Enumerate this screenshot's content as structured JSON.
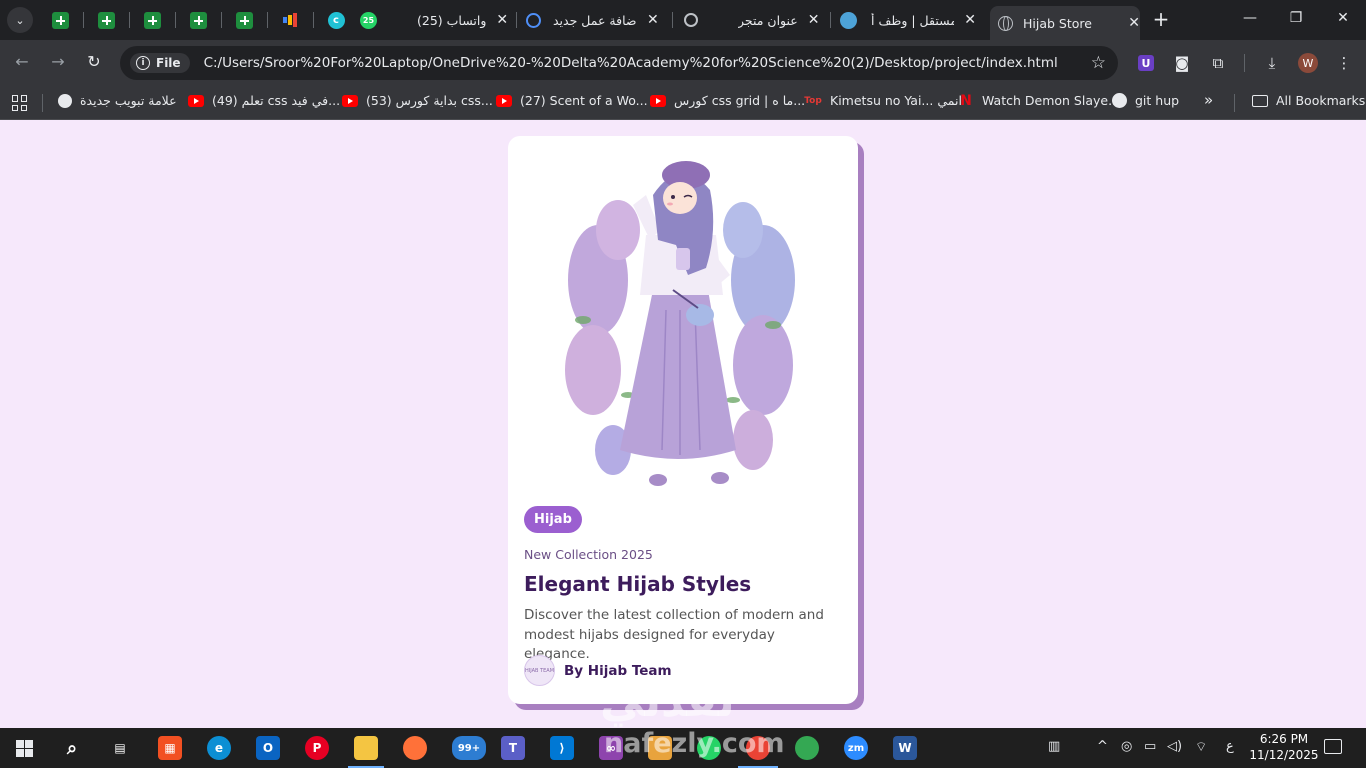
{
  "browser": {
    "tabs": [
      {
        "title": "",
        "icon": "sheets-icon"
      },
      {
        "title": "",
        "icon": "sheets-icon"
      },
      {
        "title": "",
        "icon": "sheets-icon"
      },
      {
        "title": "",
        "icon": "sheets-icon"
      },
      {
        "title": "",
        "icon": "sheets-icon"
      },
      {
        "title": "",
        "icon": "analytics-icon"
      },
      {
        "title": "",
        "icon": "canva-icon"
      },
      {
        "title": "(25) واتساب",
        "icon": "whatsapp-icon",
        "badge": "25"
      },
      {
        "title": "إضافة عمل جديد",
        "icon": "loading-icon"
      },
      {
        "title": "عنوان متجر",
        "icon": "openai-icon"
      },
      {
        "title": "مستقل | وظف أ",
        "icon": "mostaql-icon"
      },
      {
        "title": "Hijab Store",
        "icon": "globe-icon",
        "active": true
      }
    ],
    "site_label": "File",
    "url": "C:/Users/Sroor%20For%20Laptop/OneDrive%20-%20Delta%20Academy%20for%20Science%20(2)/Desktop/project/index.html",
    "profile_initial": "W",
    "extension_label": "U",
    "bookmarks": [
      {
        "label": "علامة تبويب جديدة",
        "icon": "globe-icon"
      },
      {
        "label": "(49) تعلم css في فيد...",
        "icon": "youtube-icon"
      },
      {
        "label": "(53) بداية كورس css...",
        "icon": "youtube-icon"
      },
      {
        "label": "(27) Scent of a Wo...",
        "icon": "youtube-icon"
      },
      {
        "label": "كورس css grid | ما ه...",
        "icon": "youtube-icon"
      },
      {
        "label": "Kimetsu no Yai... انمي",
        "icon": "top-icon"
      },
      {
        "label": "Watch Demon Slaye...",
        "icon": "netflix-icon"
      },
      {
        "label": "git hup",
        "icon": "github-icon"
      }
    ],
    "top_site_label": "Top",
    "netflix_label": "N",
    "more_bookmarks": "»",
    "all_bookmarks": "All Bookmarks"
  },
  "card": {
    "badge": "Hijab",
    "subtitle": "New Collection 2025",
    "title": "Elegant Hijab Styles",
    "description": "Discover the latest collection of modern and modest hijabs designed for everyday elegance.",
    "author": "By Hijab Team",
    "avatar_text": "HIJAB TEAM"
  },
  "watermark": {
    "arabic": "نفذلي",
    "latin": "nafezly.com"
  },
  "taskbar": {
    "badge_count": "99+",
    "zoom_label": "zm",
    "word_label": "W",
    "lang": "ع",
    "time": "6:26 PM",
    "date": "11/12/2025"
  },
  "colors": {
    "page_bg": "#f6e8fb",
    "accent": "#9b5fd0",
    "card_shadow": "#a87fc0",
    "title": "#3d1c5c"
  }
}
